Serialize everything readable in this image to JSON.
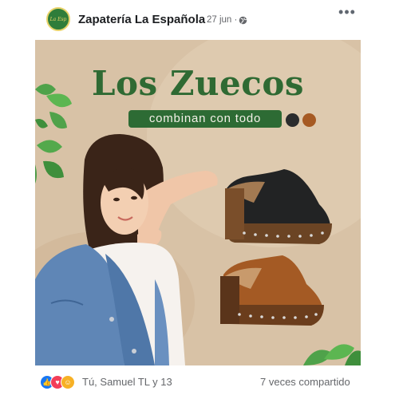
{
  "header": {
    "page_name": "Zapatería La Española",
    "date": "27 jun",
    "date_separator": "·",
    "avatar_icon": "store-logo-icon",
    "more_label": "•••"
  },
  "post_image": {
    "title": "Los Zuecos",
    "subtitle": "combinan con todo",
    "swatch_colors": [
      "#2b2c2d",
      "#a65a23"
    ],
    "accent_green": "#2d6b34",
    "background_color": "#d9c3a8"
  },
  "footer": {
    "reaction_icons": [
      "like-icon",
      "love-icon",
      "care-icon"
    ],
    "likers": "Tú, Samuel TL y 13",
    "shares": "7 veces compartido"
  }
}
